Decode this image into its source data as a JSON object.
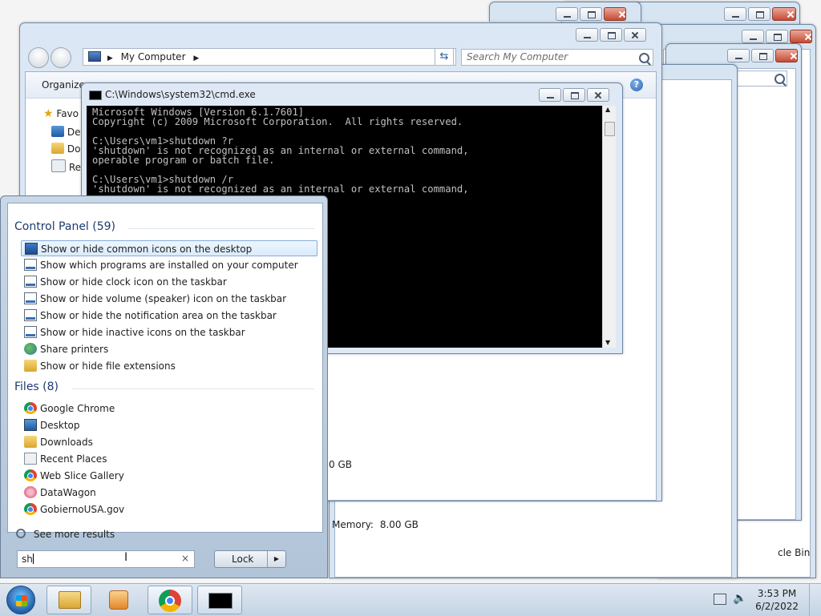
{
  "explorer": {
    "address_root": "My Computer",
    "search_placeholder": "Search My Computer",
    "organize": "Organize",
    "nav_pane": [
      "Favo",
      "Des",
      "Do",
      "Re"
    ],
    "partial_size": "0 GB",
    "memory_label": "Memory:",
    "memory_value": "8.00 GB",
    "recycle_bin_partial": "cle Bin"
  },
  "cmd": {
    "title": "C:\\Windows\\system32\\cmd.exe",
    "lines": [
      "Microsoft Windows [Version 6.1.7601]",
      "Copyright (c) 2009 Microsoft Corporation.  All rights reserved.",
      "",
      "C:\\Users\\vm1>shutdown ?r",
      "'shutdown' is not recognized as an internal or external command,",
      "operable program or batch file.",
      "",
      "C:\\Users\\vm1>shutdown /r",
      "'shutdown' is not recognized as an internal or external command,"
    ]
  },
  "start_menu": {
    "control_panel_title": "Control Panel (59)",
    "control_panel_items": [
      {
        "label": "Show or hide common icons on the desktop",
        "icon": "monitor-icon"
      },
      {
        "label": "Show which programs are installed on your computer",
        "icon": "taskbar-icon"
      },
      {
        "label": "Show or hide clock icon on the taskbar",
        "icon": "taskbar-icon"
      },
      {
        "label": "Show or hide volume (speaker) icon on the taskbar",
        "icon": "taskbar-icon"
      },
      {
        "label": "Show or hide the notification area on the taskbar",
        "icon": "taskbar-icon"
      },
      {
        "label": "Show or hide inactive icons on the taskbar",
        "icon": "taskbar-icon"
      },
      {
        "label": "Share printers",
        "icon": "printer-icon"
      },
      {
        "label": "Show or hide file extensions",
        "icon": "folder-options-icon"
      }
    ],
    "files_title": "Files (8)",
    "file_items": [
      {
        "label": "Google Chrome",
        "icon": "chrome-icon"
      },
      {
        "label": "Desktop",
        "icon": "desktop-icon"
      },
      {
        "label": "Downloads",
        "icon": "folder-icon"
      },
      {
        "label": "Recent Places",
        "icon": "recent-places-icon"
      },
      {
        "label": "Web Slice Gallery",
        "icon": "chrome-icon"
      },
      {
        "label": "DataWagon",
        "icon": "datawagon-icon"
      },
      {
        "label": "GobiernoUSA.gov",
        "icon": "chrome-icon"
      }
    ],
    "see_more": "See more results",
    "search_value": "sh",
    "lock_label": "Lock"
  },
  "taskbar": {
    "time": "3:53 PM",
    "date": "6/2/2022"
  }
}
